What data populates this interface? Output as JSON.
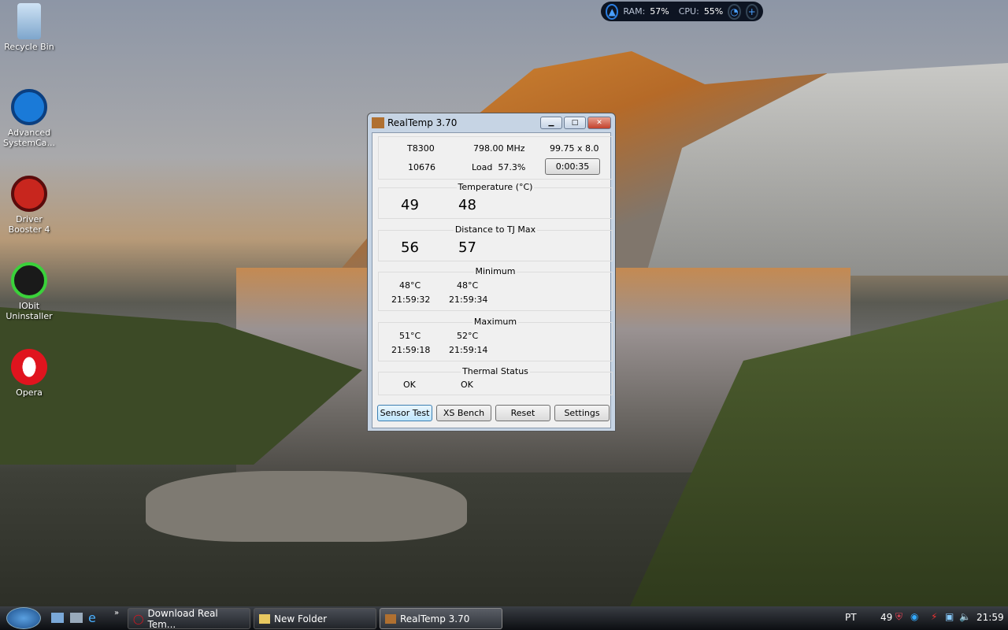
{
  "desktop": {
    "icons": [
      {
        "label": "Recycle Bin"
      },
      {
        "label": "Advanced SystemCa..."
      },
      {
        "label": "Driver Booster 4"
      },
      {
        "label": "IObit Uninstaller"
      },
      {
        "label": "Opera"
      }
    ]
  },
  "widget": {
    "ram_label": "RAM:",
    "ram_value": "57%",
    "cpu_label": "CPU:",
    "cpu_value": "55%"
  },
  "window": {
    "title": "RealTemp 3.70",
    "info": {
      "cpu": "T8300",
      "freq": "798.00 MHz",
      "multiplier": "99.75 x 8.0",
      "vid": "10676",
      "load": "Load  57.3%",
      "timer": "0:00:35"
    },
    "temperature": {
      "title": "Temperature (°C)",
      "core0": "49",
      "core1": "48"
    },
    "distance": {
      "title": "Distance to TJ Max",
      "core0": "56",
      "core1": "57"
    },
    "minimum": {
      "title": "Minimum",
      "core0_temp": "48°C",
      "core1_temp": "48°C",
      "core0_time": "21:59:32",
      "core1_time": "21:59:34"
    },
    "maximum": {
      "title": "Maximum",
      "core0_temp": "51°C",
      "core1_temp": "52°C",
      "core0_time": "21:59:18",
      "core1_time": "21:59:14"
    },
    "thermal": {
      "title": "Thermal Status",
      "core0": "OK",
      "core1": "OK"
    },
    "buttons": {
      "sensor_test": "Sensor Test",
      "xs_bench": "XS Bench",
      "reset": "Reset",
      "settings": "Settings"
    }
  },
  "taskbar": {
    "tasks": [
      {
        "label": "Download Real Tem..."
      },
      {
        "label": "New Folder"
      },
      {
        "label": "RealTemp 3.70"
      }
    ],
    "language": "PT",
    "tray_temp": "49",
    "clock": "21:59"
  }
}
